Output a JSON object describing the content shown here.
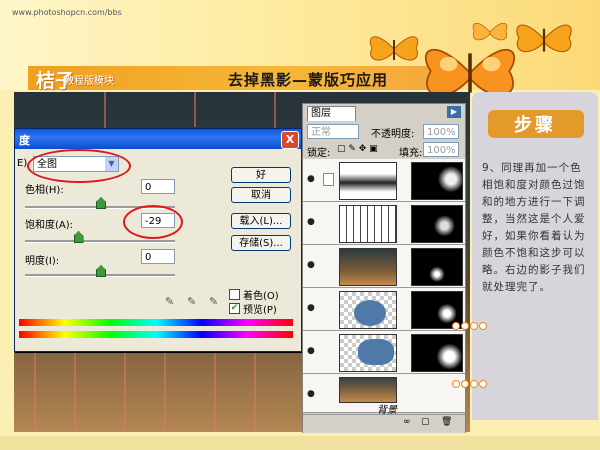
{
  "header": {
    "url": "www.photoshopcn.com/bbs",
    "logo": "桔子",
    "subtitle": "教程版模块",
    "headline": "去掉黑影—蒙版巧应用"
  },
  "dialog": {
    "title": "色相/饱和度",
    "title_visible": "度",
    "close_label": "X",
    "edit_label": "E)",
    "edit_value": "全图",
    "hue_label": "色相(H):",
    "hue_value": "0",
    "saturation_label": "饱和度(A):",
    "saturation_value": "-29",
    "lightness_label": "明度(I):",
    "lightness_value": "0",
    "ok_label": "好",
    "cancel_label": "取消",
    "load_label": "载入(L)...",
    "save_label": "存储(S)...",
    "colorize_label": "着色(O)",
    "preview_label": "预览(P)",
    "colorize_checked": false,
    "preview_checked": true,
    "hue_level": 0.5,
    "saturation_level": 0.35,
    "lightness_level": 0.5
  },
  "layers_panel": {
    "tab_label": "图层",
    "blend_mode": "正常",
    "opacity_label": "不透明度:",
    "opacity_value": "100%",
    "lock_label": "锁定:",
    "fill_label": "填充:",
    "fill_value": "100%",
    "background_layer_label": "背景"
  },
  "side_panel": {
    "title": "步骤",
    "body": "9、同理再加一个色相饱和度对颜色过饱和的地方进行一下调整，当然这是个人爱好，如果你看着认为颜色不饱和这步可以略。右边的影子我们就处理完了。"
  },
  "colors": {
    "accent": "#f0a020",
    "highlight_ring": "#e0161a",
    "titlebar": "#0a58e4"
  }
}
